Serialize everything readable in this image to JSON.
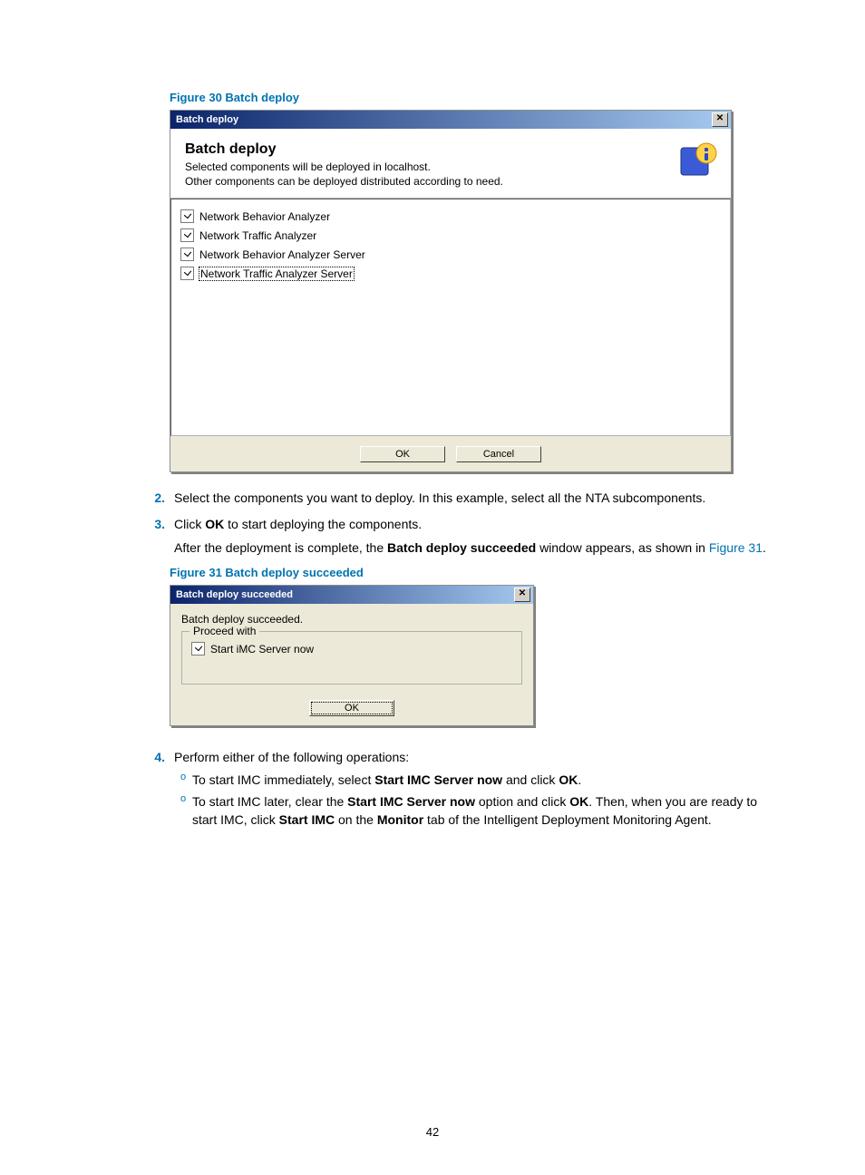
{
  "figure30": {
    "caption": "Figure 30 Batch deploy",
    "titlebar": "Batch deploy",
    "title": "Batch deploy",
    "desc1": "Selected components will be deployed in localhost.",
    "desc2": "Other components can be deployed distributed according to need.",
    "items": [
      "Network Behavior Analyzer",
      "Network Traffic Analyzer",
      "Network Behavior Analyzer Server",
      "Network Traffic Analyzer Server"
    ],
    "ok": "OK",
    "cancel": "Cancel"
  },
  "step2": {
    "num": "2.",
    "text": "Select the components you want to deploy. In this example, select all the NTA subcomponents."
  },
  "step3": {
    "num": "3.",
    "line1_a": "Click ",
    "line1_b": "OK",
    "line1_c": " to start deploying the components.",
    "line2_a": "After the deployment is complete, the ",
    "line2_b": "Batch deploy succeeded",
    "line2_c": " window appears, as shown in ",
    "line2_link": "Figure 31",
    "line2_d": "."
  },
  "figure31": {
    "caption": "Figure 31 Batch deploy succeeded",
    "titlebar": "Batch deploy succeeded",
    "msg": "Batch deploy succeeded.",
    "group": "Proceed with",
    "checkbox": "Start iMC Server now",
    "ok": "OK"
  },
  "step4": {
    "num": "4.",
    "text": "Perform either of the following operations:",
    "bullet": "o",
    "sub1_a": "To start IMC immediately, select ",
    "sub1_b": "Start IMC Server now",
    "sub1_c": " and click ",
    "sub1_d": "OK",
    "sub1_e": ".",
    "sub2_a": "To start IMC later, clear the ",
    "sub2_b": "Start IMC Server now",
    "sub2_c": " option and click ",
    "sub2_d": "OK",
    "sub2_e": ". Then, when you are ready to start IMC, click ",
    "sub2_f": "Start IMC",
    "sub2_g": " on the ",
    "sub2_h": "Monitor",
    "sub2_i": " tab of the Intelligent Deployment Monitoring Agent."
  },
  "pageNumber": "42"
}
